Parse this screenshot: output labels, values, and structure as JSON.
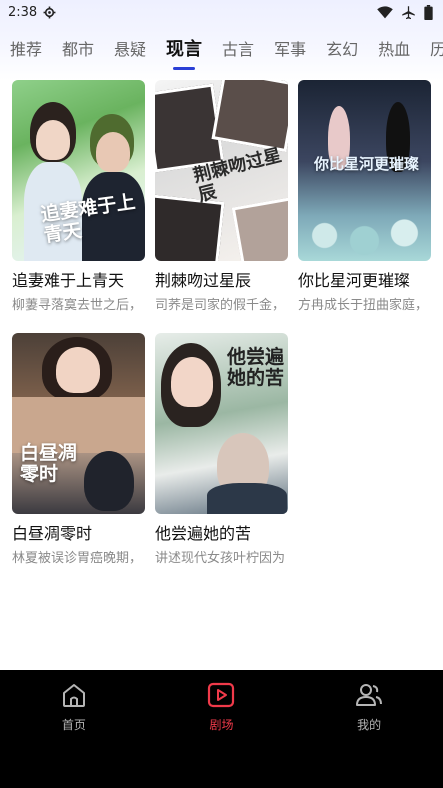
{
  "status_bar": {
    "time": "2:38",
    "icons": [
      "settings-icon",
      "wifi-icon",
      "airplane-icon",
      "battery-icon"
    ]
  },
  "tabs": [
    {
      "label": "推荐",
      "active": false
    },
    {
      "label": "都市",
      "active": false
    },
    {
      "label": "悬疑",
      "active": false
    },
    {
      "label": "现言",
      "active": true
    },
    {
      "label": "古言",
      "active": false
    },
    {
      "label": "军事",
      "active": false
    },
    {
      "label": "玄幻",
      "active": false
    },
    {
      "label": "热血",
      "active": false
    },
    {
      "label": "历史",
      "active": false
    }
  ],
  "accent_color": "#2a3fd6",
  "cards": [
    {
      "title": "追妻难于上青天",
      "desc": "柳萋寻落寞去世之后，",
      "cover_text": "追妻难于上青天"
    },
    {
      "title": "荆棘吻过星辰",
      "desc": "司荞是司家的假千金，",
      "cover_text": "荆棘吻过星辰"
    },
    {
      "title": "你比星河更璀璨",
      "desc": "方冉成长于扭曲家庭，",
      "cover_text": "你比星河更璀璨"
    },
    {
      "title": "白昼凋零时",
      "desc": "林夏被误诊胃癌晚期，",
      "cover_text": "白昼凋零时"
    },
    {
      "title": "他尝遍她的苦",
      "desc": "讲述现代女孩叶柠因为",
      "cover_text": "他尝遍她的苦"
    }
  ],
  "bottom_nav": [
    {
      "label": "首页",
      "icon": "home-icon",
      "active": false
    },
    {
      "label": "剧场",
      "icon": "play-icon",
      "active": true
    },
    {
      "label": "我的",
      "icon": "user-icon",
      "active": false
    }
  ],
  "nav_active_color": "#f03a4a"
}
